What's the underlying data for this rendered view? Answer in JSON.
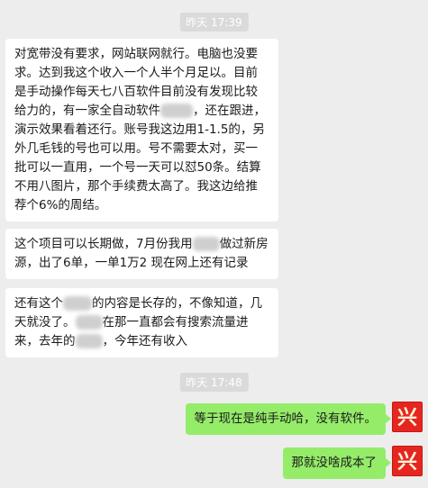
{
  "timestamps": [
    "昨天 17:39",
    "昨天 17:48"
  ],
  "messages": {
    "m1": {
      "p1": "对宽带没有要求，网站联网就行。电脑也没要求。达到我这个收入一个人半个月足以。目前是手动操作每天七八百软件目前没有发现比较给力的，有一家全自动软件",
      "p2": "，还在跟进，演示效果看着还行。账号我这边用1-1.5的，另外几毛钱的号也可以用。号不需要太对，买一批可以一直用，一个号一天可以怼50条。结算不用八图片，那个手续费太高了。我这边给推荐个6%的周结。"
    },
    "m2": {
      "p1": "这个项目可以长期做，7月份我用",
      "p2": "做过新房源，出了6单，一单1万2 现在网上还有记录"
    },
    "m3": {
      "p1": "还有这个",
      "p2": "的内容是长存的，不像知道，几天就没了。",
      "p3": "在那一直都会有搜索流量进来，去年的",
      "p4": "，今年还有收入"
    },
    "m4": "等于现在是纯手动哈，没有软件。",
    "m5": "那就没啥成本了"
  },
  "avatar": {
    "glyph": "兴",
    "icon": "avatar-xing-icon",
    "bg_color": "#e52620"
  },
  "colors": {
    "background": "#ededed",
    "incoming_bubble": "#ffffff",
    "outgoing_bubble": "#95ec69"
  }
}
